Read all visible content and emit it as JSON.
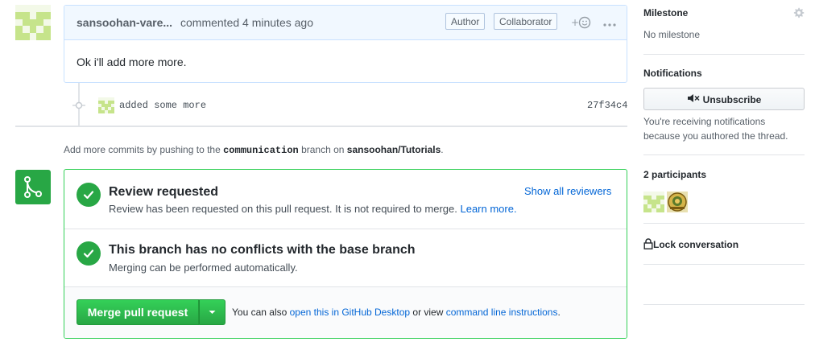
{
  "comment": {
    "author": "sansoohan-vare...",
    "meta": "commented 4 minutes ago",
    "badges": [
      "Author",
      "Collaborator"
    ],
    "body": "Ok i'll add more more.",
    "icons": [
      "add-reaction-icon",
      "more-options-icon"
    ]
  },
  "commit": {
    "message": "added some more",
    "sha": "27f34c4"
  },
  "hint": {
    "prefix": "Add more commits by pushing to the",
    "branch": "communication",
    "middle": "branch on",
    "repo": "sansoohan/Tutorials",
    "suffix": "."
  },
  "merge": {
    "review_title": "Review requested",
    "review_sub": "Review has been requested on this pull request. It is not required to merge.",
    "review_learn": "Learn more.",
    "show_reviewers": "Show all reviewers",
    "conflict_title": "This branch has no conflicts with the base branch",
    "conflict_sub": "Merging can be performed automatically.",
    "merge_button": "Merge pull request",
    "also_prefix": "You can also",
    "also_link1": "open this in GitHub Desktop",
    "also_middle": "or view",
    "also_link2": "command line instructions",
    "also_suffix": "."
  },
  "sidebar": {
    "milestone_title": "Milestone",
    "milestone_value": "No milestone",
    "notifications_title": "Notifications",
    "unsubscribe": "Unsubscribe",
    "notify_line1": "You're receiving notifications",
    "notify_line2": "because you authored the thread.",
    "participants_title": "2 participants",
    "lock": "Lock conversation"
  },
  "colors": {
    "green": "#28a745",
    "blue_link": "#0366d6",
    "comment_header": "#f1f8ff"
  }
}
